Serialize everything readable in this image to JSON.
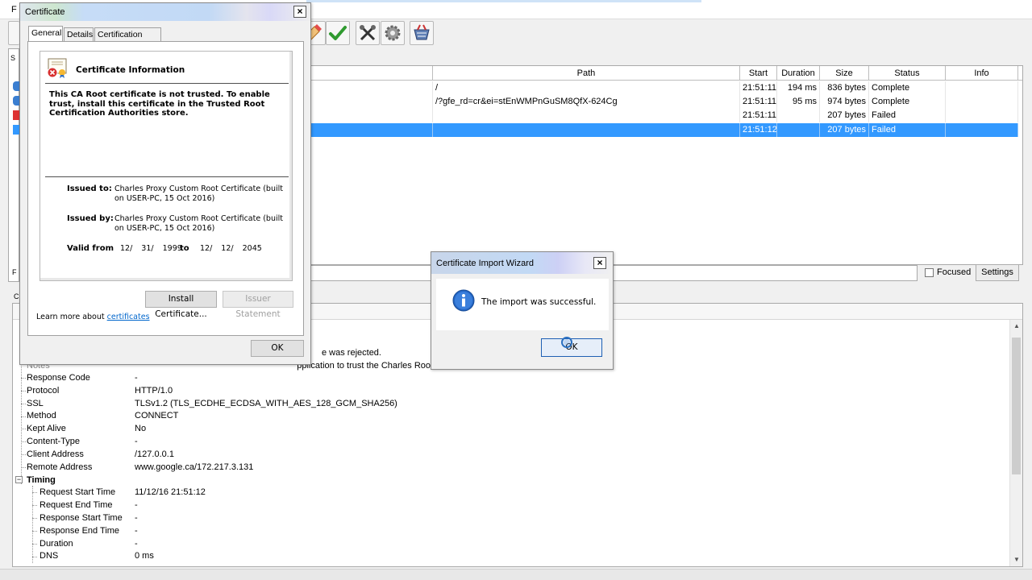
{
  "main": {
    "menu_first": "F",
    "toolbar": {
      "icons": [
        "pencil-icon",
        "checkmark-icon",
        "tools-icon",
        "gear-icon",
        "basket-icon"
      ]
    },
    "left_letters": [
      "S",
      "F",
      "C"
    ],
    "sequence": {
      "columns": [
        "Path",
        "Start",
        "Duration",
        "Size",
        "Status",
        "Info"
      ],
      "rows": [
        {
          "path": "/",
          "start": "21:51:11",
          "duration": "194 ms",
          "size": "836 bytes",
          "status": "Complete",
          "info": ""
        },
        {
          "path": "/?gfe_rd=cr&ei=stEnWMPnGuSM8QfX-624Cg",
          "start": "21:51:11",
          "duration": "95 ms",
          "size": "974 bytes",
          "status": "Complete",
          "info": ""
        },
        {
          "path": "",
          "start": "21:51:11",
          "duration": "",
          "size": "207 bytes",
          "status": "Failed",
          "info": ""
        },
        {
          "path": "",
          "start": "21:51:12",
          "duration": "",
          "size": "207 bytes",
          "status": "Failed",
          "info": ""
        }
      ]
    },
    "filter": {
      "focused_label": "Focused",
      "settings_label": "Settings"
    },
    "details": {
      "rejected_fragment": "e was rejected.",
      "notes_label": "Notes",
      "notes_fragment": "pplication to trust the Charles Roo",
      "rows": [
        {
          "key": "Response Code",
          "value": "-"
        },
        {
          "key": "Protocol",
          "value": "HTTP/1.0"
        },
        {
          "key": "SSL",
          "value": "TLSv1.2 (TLS_ECDHE_ECDSA_WITH_AES_128_GCM_SHA256)"
        },
        {
          "key": "Method",
          "value": "CONNECT"
        },
        {
          "key": "Kept Alive",
          "value": "No"
        },
        {
          "key": "Content-Type",
          "value": "-"
        },
        {
          "key": "Client Address",
          "value": "/127.0.0.1"
        },
        {
          "key": "Remote Address",
          "value": "www.google.ca/172.217.3.131"
        }
      ],
      "timing_label": "Timing",
      "timing_rows": [
        {
          "key": "Request Start Time",
          "value": "11/12/16 21:51:12"
        },
        {
          "key": "Request End Time",
          "value": "-"
        },
        {
          "key": "Response Start Time",
          "value": "-"
        },
        {
          "key": "Response End Time",
          "value": "-"
        },
        {
          "key": "Duration",
          "value": "-"
        },
        {
          "key": "DNS",
          "value": "0 ms"
        }
      ]
    }
  },
  "cert_dialog": {
    "title": "Certificate",
    "close_glyph": "×",
    "tabs": [
      "General",
      "Details",
      "Certification Path"
    ],
    "info_title": "Certificate Information",
    "warning": "This CA Root certificate is not trusted. To enable trust, install this certificate in the Trusted Root Certification Authorities store.",
    "issued_to_label": "Issued to:",
    "issued_to_value": "Charles Proxy Custom Root Certificate (built on USER-PC, 15 Oct 2016)",
    "issued_by_label": "Issued by:",
    "issued_by_value": "Charles Proxy Custom Root Certificate (built on USER-PC, 15 Oct 2016)",
    "valid_from_label": "Valid from",
    "valid_from_value": "12/ 31/ 1999",
    "to_label": "to",
    "valid_to_value": "12/ 12/ 2045",
    "install_button": "Install Certificate...",
    "issuer_statement_button": "Issuer Statement",
    "learn_more_text": "Learn more about",
    "learn_more_link": "certificates",
    "ok_button": "OK"
  },
  "import_wizard": {
    "title": "Certificate Import Wizard",
    "close_glyph": "×",
    "message": "The import was successful.",
    "ok_button": "OK",
    "icon": "info-icon"
  }
}
